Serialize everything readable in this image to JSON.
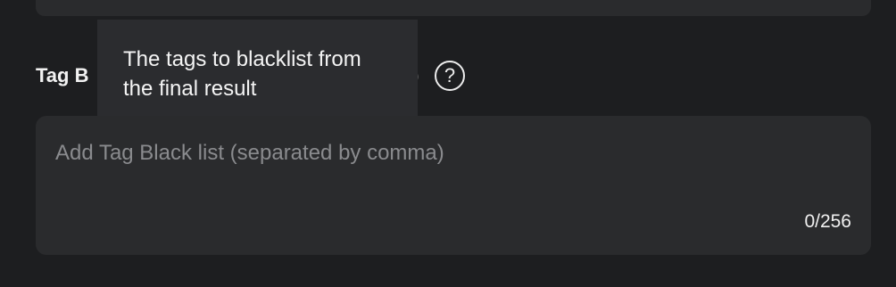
{
  "form": {
    "field_label": "Tag B",
    "label_tail": ")",
    "help_icon": "question-circle-icon",
    "help_glyph": "?",
    "tooltip": "The tags to blacklist from the final result",
    "textarea_value": "",
    "textarea_placeholder": "Add Tag Black list (separated by comma)",
    "counter": "0/256"
  },
  "colors": {
    "background": "#1d1e20",
    "field_bg": "#2a2b2d",
    "tooltip_bg": "#2b2c2f",
    "text": "#f2f2f2",
    "placeholder": "#8a8b8e"
  }
}
